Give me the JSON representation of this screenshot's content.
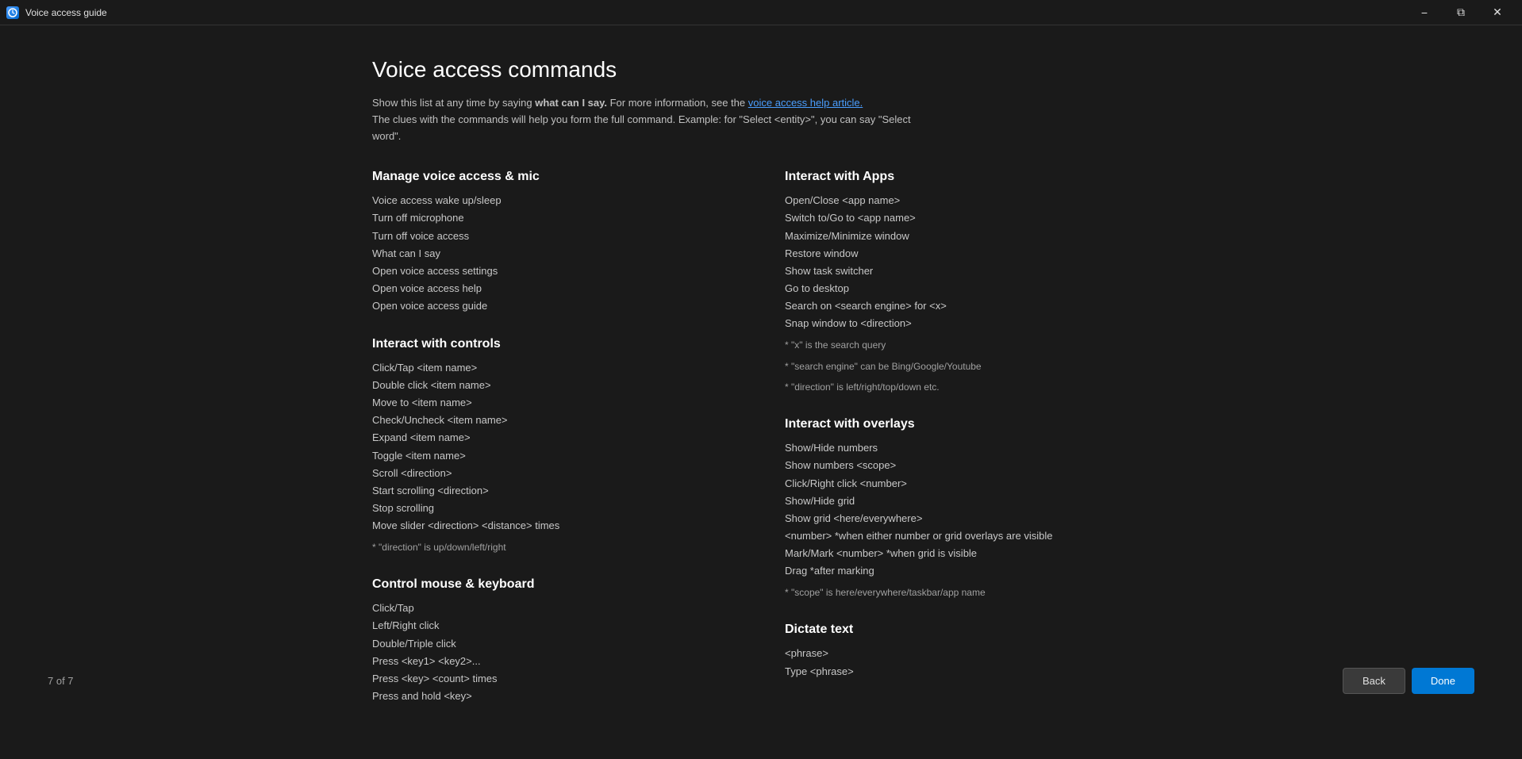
{
  "titleBar": {
    "title": "Voice access guide",
    "iconAlt": "voice-access-icon",
    "minimizeLabel": "−",
    "restoreLabel": "⧉",
    "closeLabel": "✕"
  },
  "page": {
    "title": "Voice access commands",
    "introText1": "Show this list at any time by saying ",
    "introTextBold": "what can I say.",
    "introText2": " For more information, see the ",
    "introLink": "voice access help article.",
    "introText3": "The clues with the commands will help you form the full command. Example: for \"Select <entity>\", you can say \"Select word\"."
  },
  "leftColumn": {
    "sections": [
      {
        "id": "manage-voice",
        "title": "Manage voice access & mic",
        "items": [
          "Voice access wake up/sleep",
          "Turn off microphone",
          "Turn off voice access",
          "What can I say",
          "Open voice access settings",
          "Open voice access help",
          "Open voice access guide"
        ],
        "notes": []
      },
      {
        "id": "interact-controls",
        "title": "Interact with controls",
        "items": [
          "Click/Tap <item name>",
          "Double click <item name>",
          "Move to <item name>",
          "Check/Uncheck <item name>",
          "Expand <item name>",
          "Toggle <item name>",
          "Scroll <direction>",
          "Start scrolling <direction>",
          "Stop scrolling",
          "Move slider <direction> <distance> times"
        ],
        "notes": [
          "* \"direction\" is up/down/left/right"
        ]
      },
      {
        "id": "control-mouse",
        "title": "Control mouse & keyboard",
        "items": [
          "Click/Tap",
          "Left/Right click",
          "Double/Triple click",
          "Press <key1> <key2>...",
          "Press <key> <count> times",
          "Press and hold <key>"
        ],
        "notes": []
      }
    ]
  },
  "rightColumn": {
    "sections": [
      {
        "id": "interact-apps",
        "title": "Interact with Apps",
        "items": [
          "Open/Close <app name>",
          "Switch to/Go to <app name>",
          "Maximize/Minimize window",
          "Restore window",
          "Show task switcher",
          "Go to desktop",
          "Search on <search engine> for <x>",
          "Snap window to <direction>"
        ],
        "notes": [
          "* \"x\" is the search query",
          "* \"search engine\" can be Bing/Google/Youtube",
          "* \"direction\" is left/right/top/down etc."
        ]
      },
      {
        "id": "interact-overlays",
        "title": "Interact with overlays",
        "items": [
          "Show/Hide numbers",
          "Show numbers <scope>",
          "Click/Right click <number>",
          "Show/Hide grid",
          "Show grid <here/everywhere>",
          "<number>  *when either number or grid overlays are visible",
          "Mark/Mark <number> *when grid is visible",
          "Drag *after marking"
        ],
        "notes": [
          "* \"scope\" is here/everywhere/taskbar/app name"
        ]
      },
      {
        "id": "dictate-text",
        "title": "Dictate text",
        "items": [
          "<phrase>",
          "Type <phrase>"
        ],
        "notes": []
      }
    ]
  },
  "footer": {
    "pageIndicator": "7 of 7",
    "backButton": "Back",
    "doneButton": "Done"
  }
}
